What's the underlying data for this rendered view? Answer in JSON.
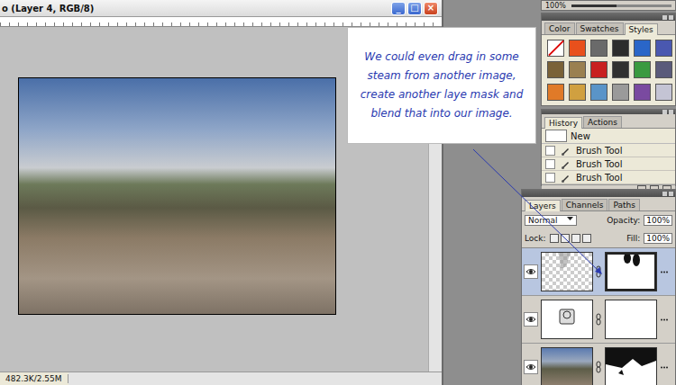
{
  "document": {
    "title": "o (Layer 4, RGB/8)",
    "controls": [
      "_",
      "□",
      "×"
    ],
    "status": "482.3K/2.55M"
  },
  "navigator": {
    "zoom": "100%",
    "level": 0.45
  },
  "callout": {
    "text": "We could even drag in some steam from another image, create another laye mask and blend that into our image."
  },
  "styles_panel": {
    "tabs": [
      {
        "label": "Color",
        "selected": false
      },
      {
        "label": "Swatches",
        "selected": false
      },
      {
        "label": "Styles",
        "selected": true
      }
    ],
    "swatches": [
      {
        "kind": "none",
        "color": "#ffffff"
      },
      {
        "kind": "color",
        "color": "#e8501c"
      },
      {
        "kind": "color",
        "color": "#6a6a6a"
      },
      {
        "kind": "color",
        "color": "#2c2c2c"
      },
      {
        "kind": "color",
        "color": "#2a66c8"
      },
      {
        "kind": "color",
        "color": "#4a58b0"
      },
      {
        "kind": "color",
        "color": "#7a6238"
      },
      {
        "kind": "color",
        "color": "#9a8050"
      },
      {
        "kind": "color",
        "color": "#c82020"
      },
      {
        "kind": "color",
        "color": "#303030"
      },
      {
        "kind": "color",
        "color": "#3a9a40"
      },
      {
        "kind": "color",
        "color": "#5a5a7a"
      },
      {
        "kind": "color",
        "color": "#e07a28"
      },
      {
        "kind": "color",
        "color": "#d0a040"
      },
      {
        "kind": "color",
        "color": "#5a94c8"
      },
      {
        "kind": "color",
        "color": "#9a9a9a"
      },
      {
        "kind": "color",
        "color": "#7a4aa0"
      },
      {
        "kind": "color",
        "color": "#c4c4d4"
      }
    ]
  },
  "history_panel": {
    "tabs": [
      {
        "label": "History",
        "selected": true
      },
      {
        "label": "Actions",
        "selected": false
      }
    ],
    "snapshot": "New",
    "items": [
      {
        "label": "Brush Tool"
      },
      {
        "label": "Brush Tool"
      },
      {
        "label": "Brush Tool"
      }
    ]
  },
  "layers_panel": {
    "tabs": [
      {
        "label": "Layers",
        "selected": true
      },
      {
        "label": "Channels",
        "selected": false
      },
      {
        "label": "Paths",
        "selected": false
      }
    ],
    "blend_mode": "Normal",
    "opacity_label": "Opacity:",
    "opacity": "100%",
    "lock_label": "Lock:",
    "fill_label": "Fill:",
    "fill": "100%",
    "layers": [
      {
        "kind": "transparent",
        "visible": true,
        "selected": true
      },
      {
        "kind": "icon",
        "visible": true,
        "selected": false
      },
      {
        "kind": "photo",
        "visible": true,
        "selected": false
      }
    ]
  }
}
